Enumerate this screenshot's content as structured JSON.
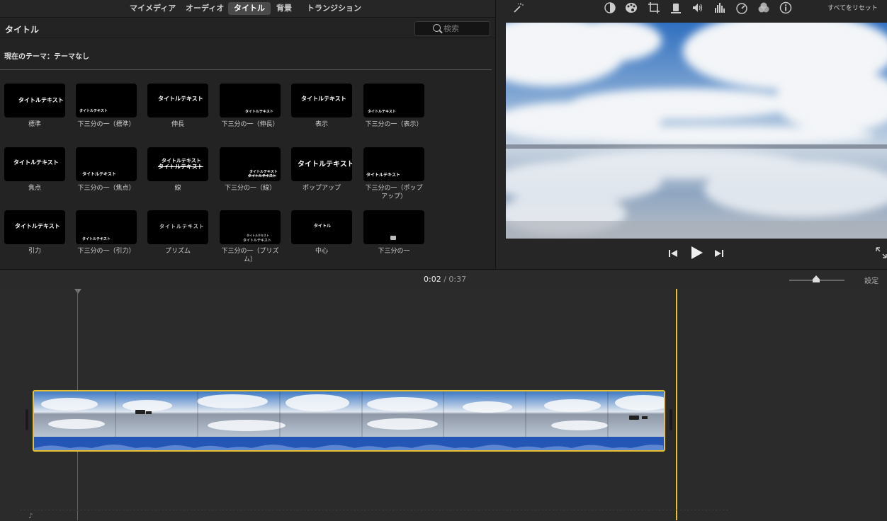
{
  "nav": {
    "tabs": [
      "マイメディア",
      "オーディオ",
      "タイトル",
      "背景",
      "トランジション"
    ],
    "active": "タイトル"
  },
  "browser": {
    "title": "タイトル",
    "search_placeholder": "検索",
    "theme": "現在のテーマ：テーマなし"
  },
  "tiles": [
    {
      "thumb": "タイトルテキスト",
      "label": "標準"
    },
    {
      "thumb": "タイトルテキスト",
      "label": "下三分の一（標準）"
    },
    {
      "thumb": "タイトルテキスト",
      "label": "伸長"
    },
    {
      "thumb": "タイトルテキスト",
      "label": "下三分の一（伸長）"
    },
    {
      "thumb": "タイトルテキスト",
      "label": "表示"
    },
    {
      "thumb": "タイトルテキスト",
      "label": "下三分の一（表示）"
    },
    {
      "thumb": "タイトルテキスト",
      "label": "焦点"
    },
    {
      "thumb": "タイトルテキスト",
      "label": "下三分の一（焦点）"
    },
    {
      "thumb": "タイトルテキスト",
      "label": "線"
    },
    {
      "thumb": "タイトルテキスト",
      "label": "下三分の一（線）"
    },
    {
      "thumb": "タイトルテキスト",
      "label": "ポップアップ"
    },
    {
      "thumb": "タイトルテキスト",
      "label": "下三分の一（ポップアップ）"
    },
    {
      "thumb": "タイトルテキスト",
      "label": "引力"
    },
    {
      "thumb": "タイトルテキスト",
      "label": "下三分の一（引力）"
    },
    {
      "thumb": "タイトルテキスト",
      "label": "プリズム"
    },
    {
      "thumb": "タイトルテキスト",
      "label": "下三分の一（プリズム）"
    },
    {
      "thumb": "タイトル",
      "label": "中心"
    },
    {
      "thumb": "",
      "label": "下三分の一"
    }
  ],
  "viewer": {
    "reset_label": "すべてをリセット",
    "tool_icons": [
      "magic-wand-icon",
      "color-balance-icon",
      "color-correction-icon",
      "crop-icon",
      "stabilization-icon",
      "volume-icon",
      "noise-reduction-icon",
      "speed-icon",
      "clip-filter-icon",
      "info-icon"
    ]
  },
  "timeline": {
    "current": "0:02",
    "separator": "/",
    "total": "0:37",
    "settings_label": "設定"
  },
  "colors": {
    "accent_yellow": "#e8c22e",
    "audio_blue": "#2457b5"
  }
}
